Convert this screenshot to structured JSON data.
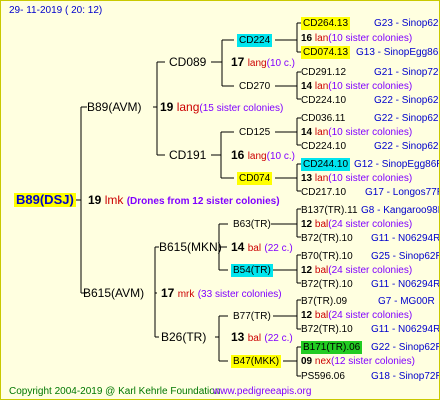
{
  "header": {
    "date": "29- 11-2019 ( 20: 12)"
  },
  "root": {
    "name": "B89(DSJ)",
    "count": "19",
    "lang": "lmk",
    "note": "(Drones from 12 sister colonies)"
  },
  "level1": [
    {
      "name": "B89(AVM)",
      "count": "19",
      "lang": "lang",
      "sis": "(15 sister colonies)"
    },
    {
      "name": "B615(AVM)",
      "count": "17",
      "lang": "mrk",
      "sis": "(33 sister colonies)"
    }
  ],
  "level2": [
    {
      "name": "CD089",
      "count": "17",
      "lang": "lang",
      "sis": "(10 c.)"
    },
    {
      "name": "CD191",
      "count": "16",
      "lang": "lang",
      "sis": "(10 c.)"
    },
    {
      "name": "B615(MKN)",
      "count": "14",
      "lang": "bal",
      "sis": "(22 c.)"
    },
    {
      "name": "B26(TR)",
      "count": "13",
      "lang": "bal",
      "sis": "(22 c.)"
    }
  ],
  "level3": [
    {
      "name": "CD224"
    },
    {
      "name": "CD270"
    },
    {
      "name": "CD125"
    },
    {
      "name": "CD074"
    },
    {
      "name": "B63(TR)"
    },
    {
      "name": "B54(TR)"
    },
    {
      "name": "B77(TR)"
    },
    {
      "name": "B47(MKK)"
    }
  ],
  "level4": [
    {
      "t": "CD264.13",
      "ref": "G23 - Sinop62R"
    },
    {
      "c": "16",
      "l": "lan",
      "s": "(10 sister colonies)"
    },
    {
      "t": "CD074.13",
      "ref": "G13 - SinopEgg86R"
    },
    {
      "t": "CD291.12",
      "ref": "G21 - Sinop72R"
    },
    {
      "c": "14",
      "l": "lan",
      "s": "(10 sister colonies)"
    },
    {
      "t": "CD224.10",
      "ref": "G22 - Sinop62R"
    },
    {
      "t": "CD036.11",
      "ref": "G22 - Sinop62R"
    },
    {
      "c": "14",
      "l": "lan",
      "s": "(10 sister colonies)"
    },
    {
      "t": "CD224.10",
      "ref": "G22 - Sinop62R"
    },
    {
      "t": "CD244.10",
      "ref": "G12 - SinopEgg86R"
    },
    {
      "c": "13",
      "l": "lan",
      "s": "(10 sister colonies)"
    },
    {
      "t": "CD217.10",
      "ref": "G17 - Longos77R"
    },
    {
      "t": "B137(TR).11",
      "ref": "G8 - Kangaroo98R"
    },
    {
      "c": "12",
      "l": "bal",
      "s": "(24 sister colonies)"
    },
    {
      "t": "B72(TR).10",
      "ref": "G11 - N06294R"
    },
    {
      "t": "B70(TR).10",
      "ref": "G25 - Sinop62R"
    },
    {
      "c": "12",
      "l": "bal",
      "s": "(24 sister colonies)"
    },
    {
      "t": "B72(TR).10",
      "ref": "G11 - N06294R"
    },
    {
      "t": "B7(TR).09",
      "ref": "G7 - MG00R"
    },
    {
      "c": "12",
      "l": "bal",
      "s": "(24 sister colonies)"
    },
    {
      "t": "B72(TR).10",
      "ref": "G11 - N06294R"
    },
    {
      "t": "B171(TR).06",
      "ref": "G22 - Sinop62R"
    },
    {
      "c": "09",
      "l": "nex",
      "s": "(12 sister colonies)"
    },
    {
      "t": "PS596.06",
      "ref": "G18 - Sinop72R"
    }
  ],
  "footer": {
    "copyright": "Copyright 2004-2019 @ Karl Kehrle Foundation",
    "site": "www.pedigreeapis.org"
  }
}
